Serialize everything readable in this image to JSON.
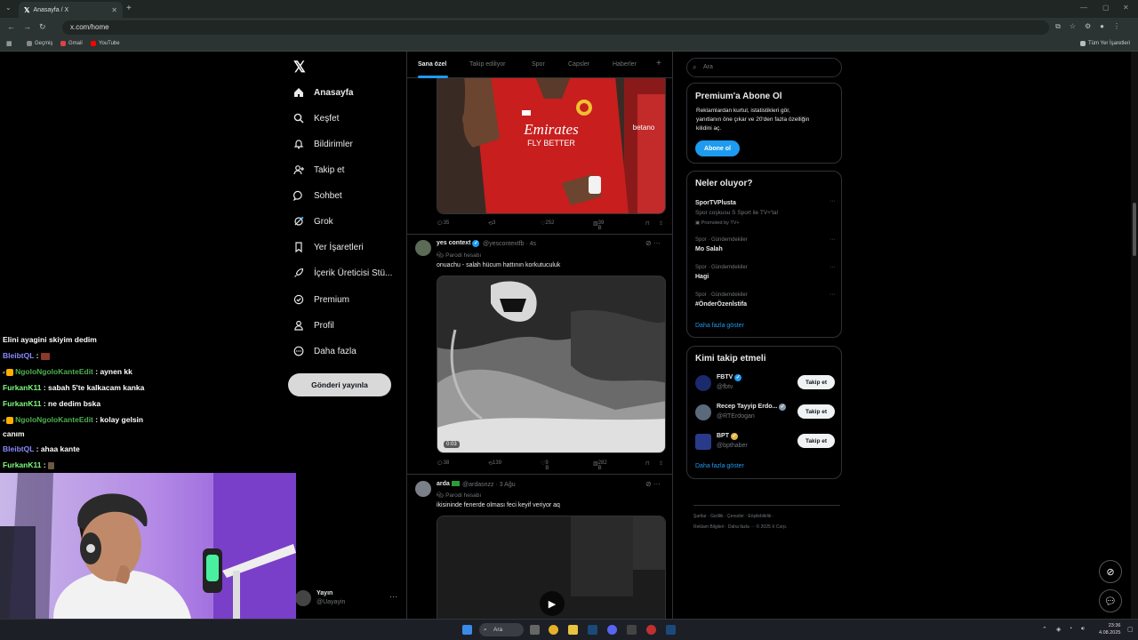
{
  "browser": {
    "tab_title": "Anasayfa / X",
    "url": "x.com/home",
    "bookmarks": [
      "Geçmiş",
      "Gmail",
      "YouTube"
    ],
    "all_bookmarks": "Tüm Yer İşaretleri"
  },
  "nav": {
    "items": [
      {
        "label": "Anasayfa",
        "icon": "home-icon"
      },
      {
        "label": "Keşfet",
        "icon": "search-icon"
      },
      {
        "label": "Bildirimler",
        "icon": "bell-icon"
      },
      {
        "label": "Takip et",
        "icon": "add-user-icon"
      },
      {
        "label": "Sohbet",
        "icon": "chat-icon"
      },
      {
        "label": "Grok",
        "icon": "grok-icon"
      },
      {
        "label": "Yer İşaretleri",
        "icon": "bookmark-icon"
      },
      {
        "label": "İçerik Üreticisi Stü...",
        "icon": "rocket-icon"
      },
      {
        "label": "Premium",
        "icon": "check-badge-icon"
      },
      {
        "label": "Profil",
        "icon": "person-icon"
      },
      {
        "label": "Daha fazla",
        "icon": "more-circle-icon"
      }
    ],
    "post_button": "Gönderi yayınla",
    "profile_name": "Yayın",
    "profile_handle": "@Uayayin"
  },
  "timeline": {
    "tabs": [
      "Sana özel",
      "Takip ediliyor",
      "Spor",
      "Capsler",
      "Haberler"
    ],
    "tweet1": {
      "shirt_text1": "Emirates",
      "shirt_text2": "FLY BETTER",
      "replies": "35",
      "retweets": "3",
      "likes": "252",
      "views": "39 B"
    },
    "tweet2": {
      "name": "yes context",
      "handle": "@yescontextfb · 4s",
      "parody": "Parodi hesabı",
      "text": "onuachu - salah hücum hattının korkutuculuk",
      "video_time": "0:03",
      "replies": "38",
      "retweets": "139",
      "likes": "9 B",
      "views": "282 B"
    },
    "tweet3": {
      "name": "arda",
      "handle": "@ardasnzz · 3 Ağu",
      "parody": "Parodi hesabı",
      "text": "ikisininde fenerde olması feci keyif veriyor aq"
    }
  },
  "right": {
    "search_placeholder": "Ara",
    "premium_title": "Premium'a Abone Ol",
    "premium_text1": "Reklamlardan kurtul, istatistikleri gör,",
    "premium_text2": "yanıtlanın öne çıkar ve 20'den fazla özelliğin",
    "premium_text3": "kilidini aç.",
    "premium_button": "Abone ol",
    "trends_title": "Neler oluyor?",
    "trends": [
      {
        "meta": "",
        "title": "SporTVPlusta",
        "sub": "Spor coşkusu S Sport ile TV+'ta!",
        "promo": "Promoted by TV+"
      },
      {
        "meta": "Spor · Gündemdekiler",
        "title": "Mo Salah"
      },
      {
        "meta": "Spor · Gündemdekiler",
        "title": "Hagi"
      },
      {
        "meta": "Spor · Gündemdekiler",
        "title": "#ÖnderÖzenİstifa"
      }
    ],
    "show_more": "Daha fazla göster",
    "who_title": "Kimi takip etmeli",
    "who": [
      {
        "name": "FBTV",
        "handle": "@fbtv",
        "button": "Takip et"
      },
      {
        "name": "Recep Tayyip Erdo...",
        "handle": "@RTErdogan",
        "button": "Takip et"
      },
      {
        "name": "BPT",
        "handle": "@bpthaber",
        "button": "Takip et"
      }
    ],
    "who_more": "Daha fazla göster",
    "footer1": "Şartlar · Gizlilik · Çerezler · Erişilebilirlik ·",
    "footer2": "Reklam Bilgileri · Daha fazla ··· © 2025 X Corp."
  },
  "chat": [
    {
      "user": "",
      "text": "Elini ayagini skiyim dedim"
    },
    {
      "user": "BleibtQL",
      "text": " : "
    },
    {
      "user": "NgoloNgoloKanteEdit",
      "text": " : aynen kk"
    },
    {
      "user": "FurkanK11",
      "text": " : sabah 5'te kalkacam kanka"
    },
    {
      "user": "FurkanK11",
      "text": " : ne dedim bska"
    },
    {
      "user": "NgoloNgoloKanteEdit",
      "text": " : kolay gelsin"
    },
    {
      "user": "",
      "text": "canım"
    },
    {
      "user": "BleibtQL",
      "text": " : ahaa kante"
    },
    {
      "user": "FurkanK11",
      "text": " : "
    }
  ],
  "taskbar": {
    "search": "Ara",
    "time": "23:36",
    "date": "4.08.2025"
  },
  "colors": {
    "accent": "#1d9bf0",
    "bg": "#000000",
    "border": "#2f3336"
  }
}
